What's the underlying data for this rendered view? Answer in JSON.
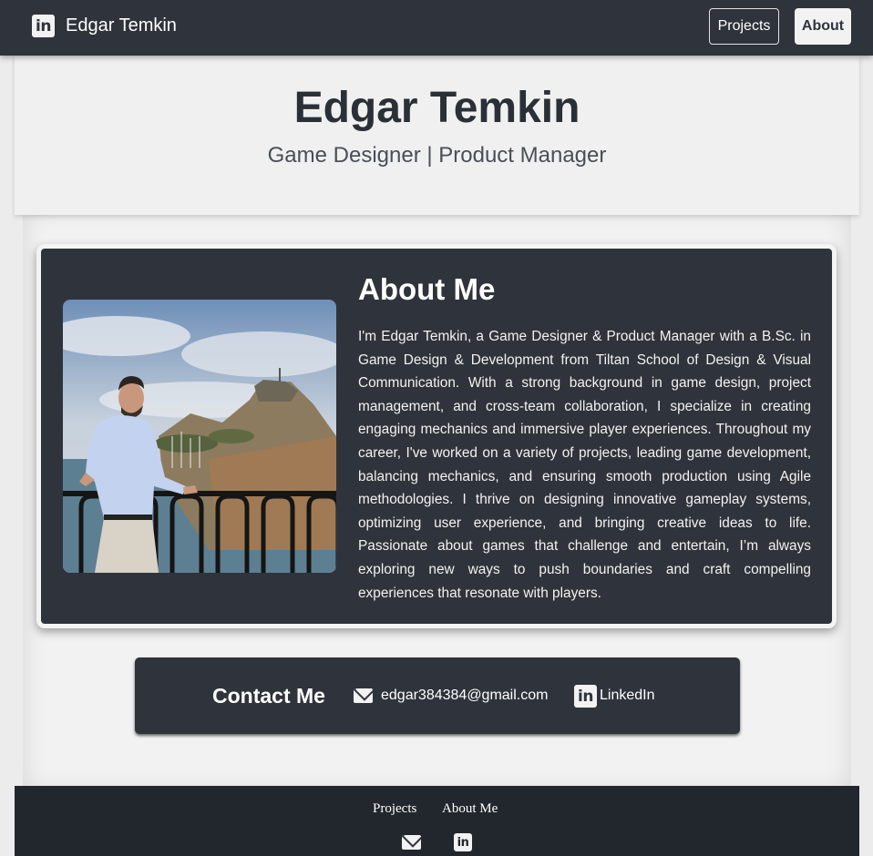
{
  "navbar": {
    "brand_icon": "linkedin-icon",
    "brand_name": "Edgar Temkin",
    "projects_label": "Projects",
    "about_label": "About"
  },
  "hero": {
    "name": "Edgar Temkin",
    "subtitle": "Game Designer | Product Manager"
  },
  "about": {
    "title": "About Me",
    "text": "I'm Edgar Temkin, a Game Designer & Product Manager with a B.Sc. in Game Design & Development from Tiltan School of Design & Visual Communication. With a strong background in game design, project management, and cross-team collaboration, I specialize in creating engaging mechanics and immersive player experiences. Throughout my career, I've worked on a variety of projects, leading game development, balancing mechanics, and ensuring smooth production using Agile methodologies. I thrive on designing innovative gameplay systems, optimizing user experience, and bringing creative ideas to life. Passionate about games that challenge and entertain, I’m always exploring new ways to push boundaries and craft compelling experiences that resonate with players."
  },
  "contact": {
    "title": "Contact Me",
    "email": "edgar384384@gmail.com",
    "linkedin_label": "LinkedIn",
    "li_glyph": "in"
  },
  "footer": {
    "projects_label": "Projects",
    "about_label": "About Me"
  },
  "colors": {
    "dark": "#2f333b",
    "footer": "#22262d",
    "page_bg": "#ececec"
  }
}
